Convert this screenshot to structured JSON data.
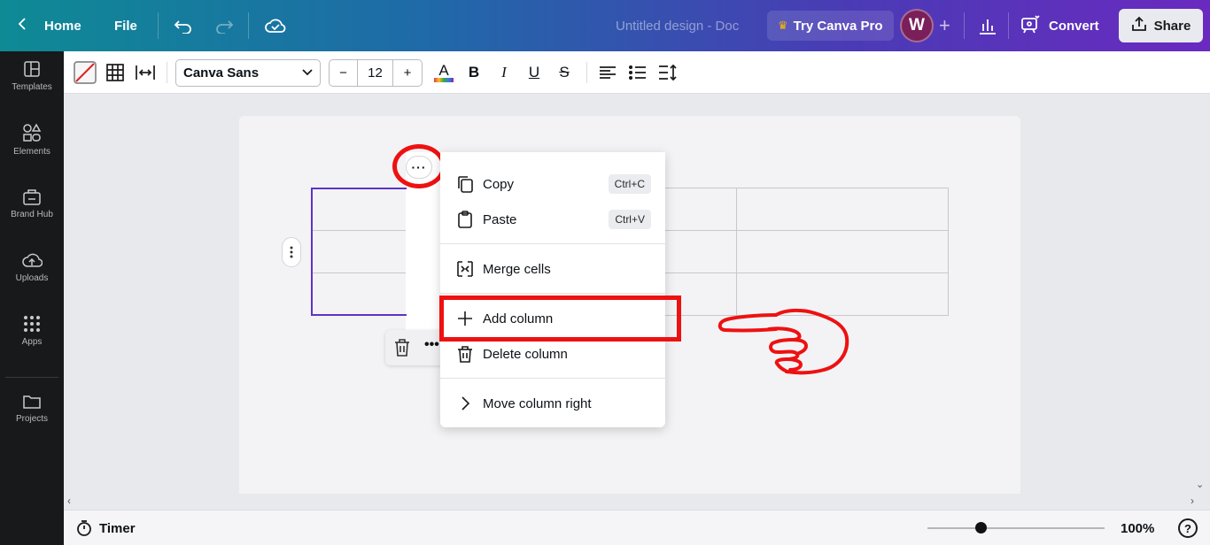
{
  "topbar": {
    "home_label": "Home",
    "file_label": "File",
    "doc_title": "Untitled design - Doc",
    "pro_label": "Try Canva Pro",
    "avatar_initial": "W",
    "convert_label": "Convert",
    "share_label": "Share"
  },
  "sidebar": {
    "items": [
      {
        "label": "Templates",
        "icon": "templates-icon"
      },
      {
        "label": "Elements",
        "icon": "elements-icon"
      },
      {
        "label": "Brand Hub",
        "icon": "brand-hub-icon"
      },
      {
        "label": "Uploads",
        "icon": "uploads-icon"
      },
      {
        "label": "Apps",
        "icon": "apps-icon"
      },
      {
        "label": "Projects",
        "icon": "projects-icon"
      }
    ]
  },
  "toolbar": {
    "font_name": "Canva Sans",
    "font_size": "12",
    "minus": "−",
    "plus": "+",
    "bold": "B",
    "italic": "I",
    "underline": "U",
    "strike": "S",
    "text_color_glyph": "A"
  },
  "context_menu": {
    "items": [
      {
        "label": "Copy",
        "shortcut": "Ctrl+C"
      },
      {
        "label": "Paste",
        "shortcut": "Ctrl+V"
      },
      {
        "label": "Merge cells"
      },
      {
        "label": "Add column"
      },
      {
        "label": "Delete column"
      },
      {
        "label": "Move column right"
      }
    ]
  },
  "canvas": {
    "column_menu_glyph": "···"
  },
  "footer": {
    "timer_label": "Timer",
    "zoom_label": "100%",
    "zoom_level": 0.3,
    "help_glyph": "?"
  },
  "colors": {
    "highlight": "#ee1111",
    "selection": "#5d34c4"
  }
}
